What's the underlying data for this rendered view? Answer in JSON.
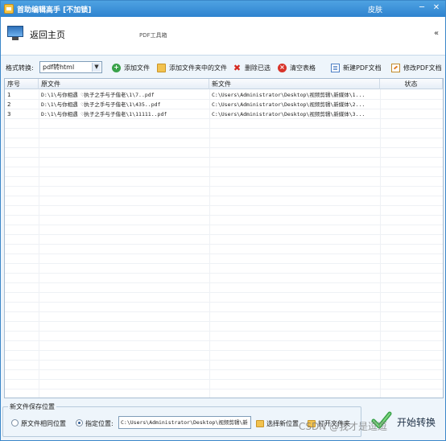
{
  "window": {
    "title": "首助编辑高手 [不加锁]",
    "skin_label": "皮肤",
    "minimize": "─",
    "close": "✕"
  },
  "header": {
    "home_label": "返回主页",
    "section_label": "PDF工具箱",
    "collapse_label": "«"
  },
  "toolbar": {
    "format_label": "格式转换:",
    "format_value": "pdf转html",
    "add_file": "添加文件",
    "add_folder": "添加文件夹中的文件",
    "delete_selected": "删除已选",
    "clear_table": "清空表格",
    "new_pdf": "新建PDF文档",
    "edit_pdf": "修改PDF文档"
  },
  "table": {
    "columns": [
      "序号",
      "原文件",
      "新文件",
      "状态"
    ],
    "rows": [
      {
        "no": "1",
        "source": "D:\\1\\与你相遇 ♡执子之手与子偕老\\1\\7..pdf",
        "target": "C:\\Users\\Administrator\\Desktop\\视频剪辑\\新媒体\\1...",
        "status": ""
      },
      {
        "no": "2",
        "source": "D:\\1\\与你相遇 ♡执子之手与子偕老\\1\\435..pdf",
        "target": "C:\\Users\\Administrator\\Desktop\\视频剪辑\\新媒体\\2...",
        "status": ""
      },
      {
        "no": "3",
        "source": "D:\\1\\与你相遇 ♡执子之手与子偕老\\1\\11111..pdf",
        "target": "C:\\Users\\Administrator\\Desktop\\视频剪辑\\新媒体\\3...",
        "status": ""
      }
    ]
  },
  "save": {
    "group_label": "新文件保存位置",
    "option_same": "原文件相同位置",
    "option_custom": "指定位置:",
    "path_value": "C:\\Users\\Administrator\\Desktop\\视频剪辑\\新",
    "choose_location": "选择新位置",
    "open_folder": "打开文件夹",
    "selected_option": "custom"
  },
  "actions": {
    "start_label": "开始转换"
  },
  "watermark": "CSDN @我才是逗逗",
  "colors": {
    "titlebar": "#3a8fd6",
    "accent_green": "#3aa24a",
    "delete_red": "#d5281e"
  }
}
